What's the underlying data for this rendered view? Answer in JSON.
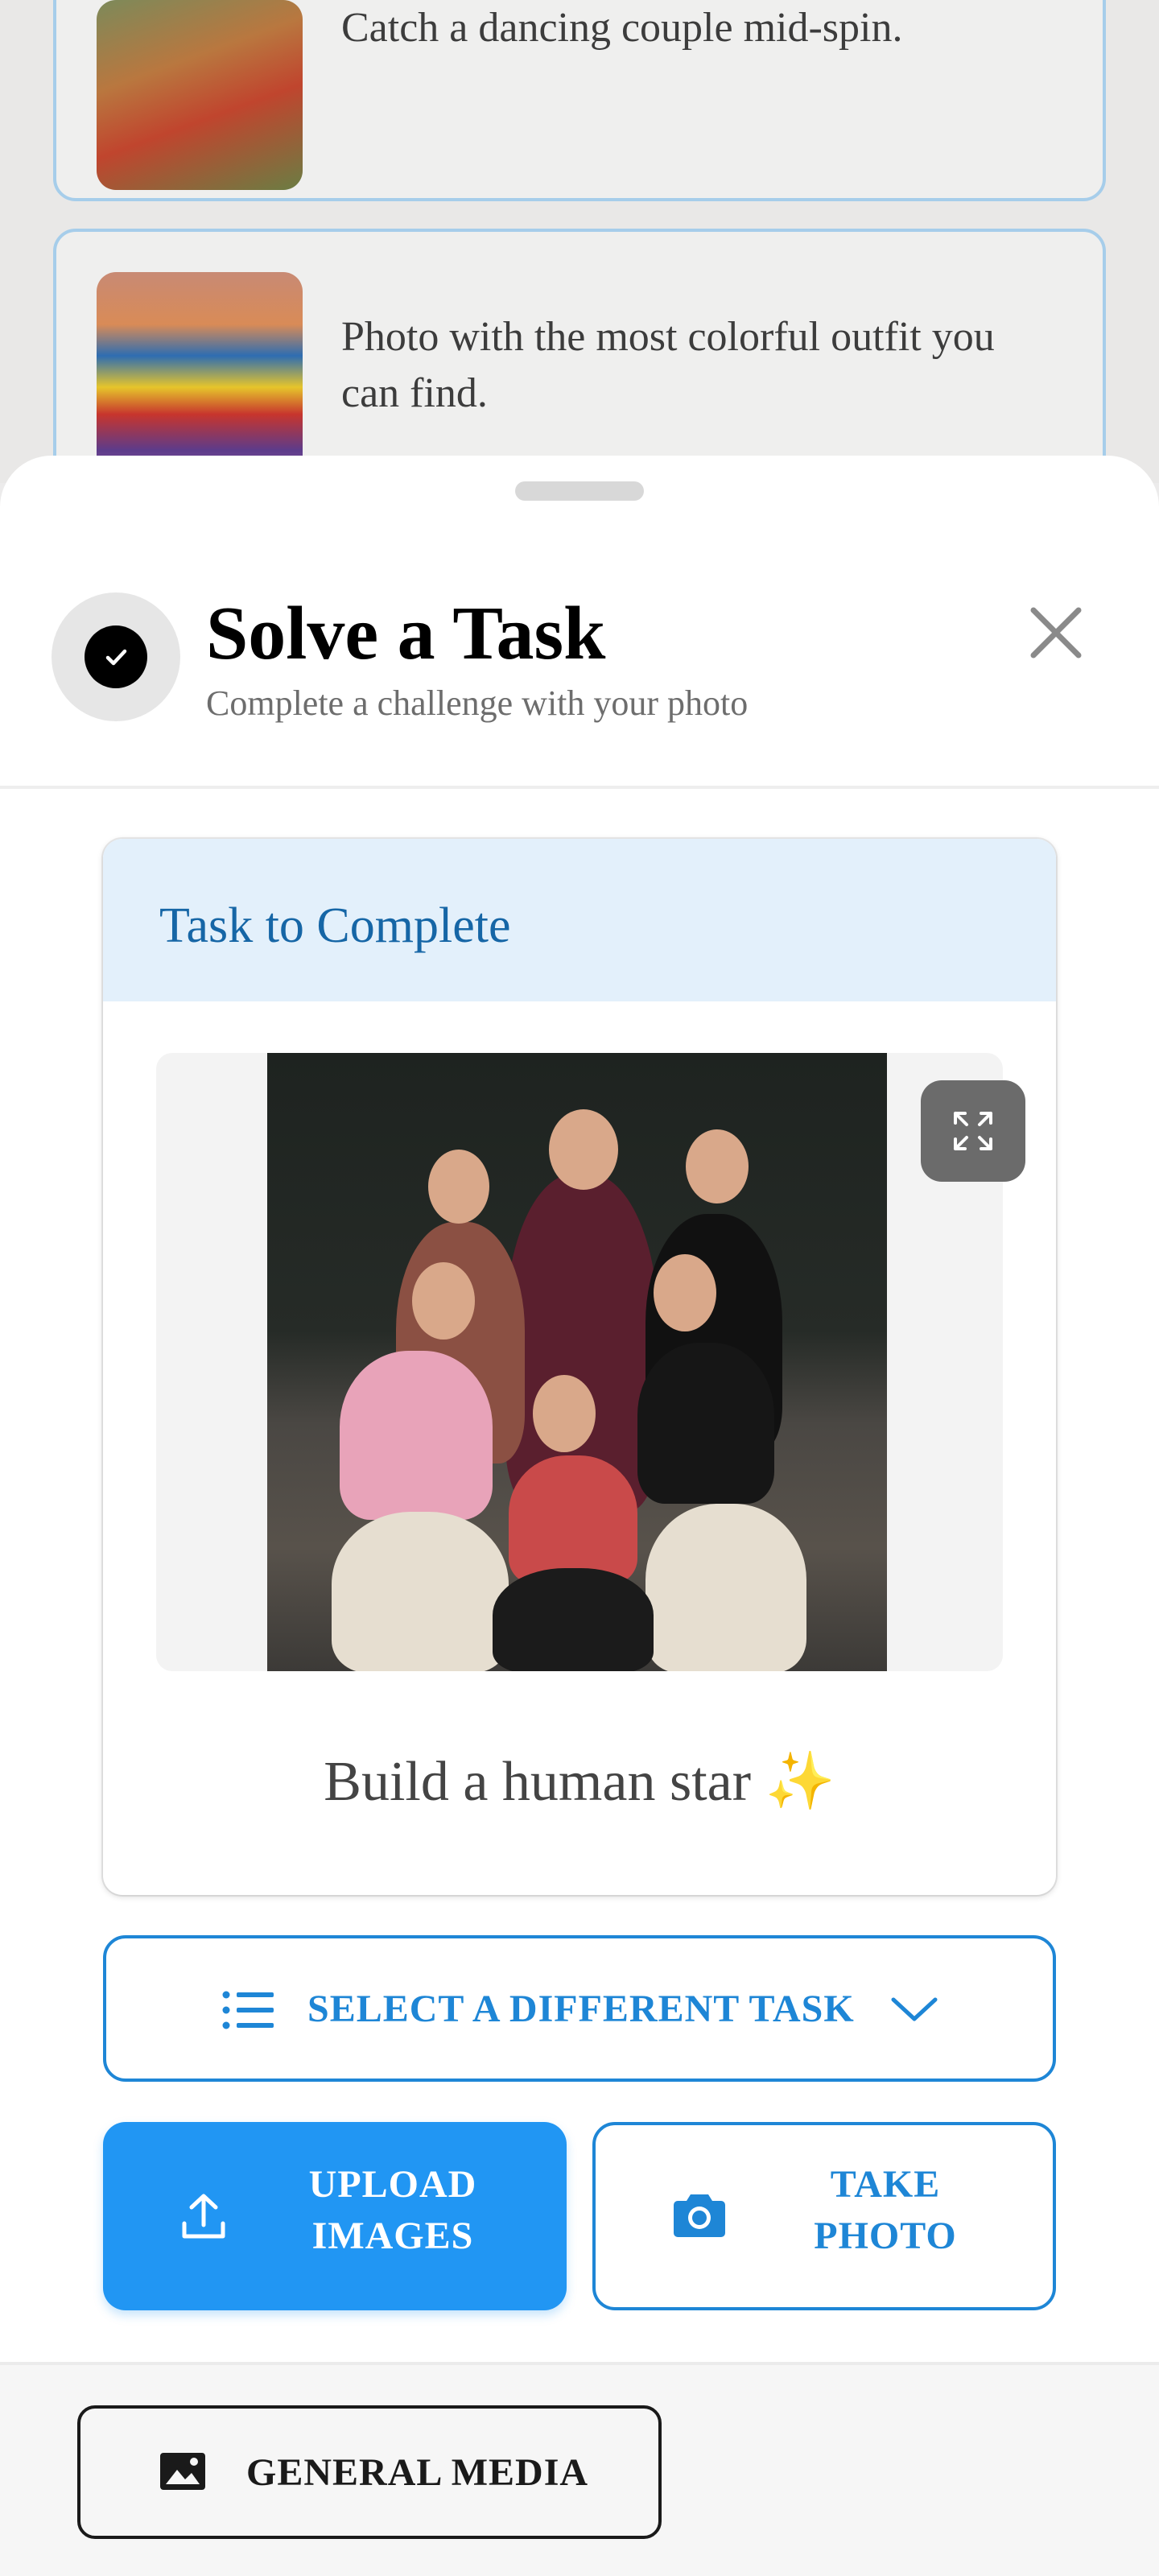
{
  "background_list": {
    "items": [
      {
        "text": "Catch a dancing couple mid-spin."
      },
      {
        "text": "Photo with the most colorful outfit you can find."
      }
    ]
  },
  "sheet": {
    "title": "Solve a Task",
    "subtitle": "Complete a challenge with your photo",
    "icons": {
      "header": "check-circle-icon",
      "close": "close-icon",
      "expand": "expand-icon",
      "list": "list-icon",
      "chevron": "chevron-down-icon",
      "upload": "upload-icon",
      "camera": "camera-icon",
      "image": "image-icon"
    }
  },
  "task_card": {
    "heading": "Task to Complete",
    "task_text": "Build a human star",
    "task_emoji": "✨"
  },
  "actions": {
    "select_task_label": "SELECT A DIFFERENT TASK",
    "upload_label_line1": "UPLOAD",
    "upload_label_line2": "IMAGES",
    "photo_label_line1": "TAKE",
    "photo_label_line2": "PHOTO"
  },
  "footer": {
    "general_media_label": "GENERAL MEDIA"
  },
  "colors": {
    "accent": "#2196f3",
    "accent_text": "#1e86d6",
    "card_header_bg": "#e3f0fb",
    "card_border": "#a6cdea"
  }
}
